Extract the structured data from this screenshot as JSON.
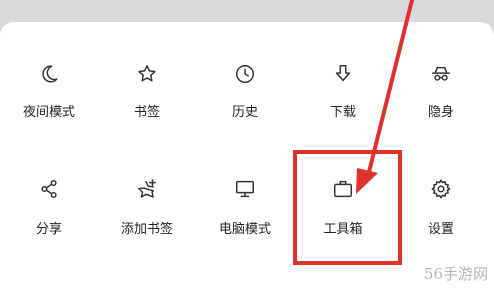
{
  "menu": {
    "row1": [
      {
        "label": "夜间模式",
        "icon": "moon-icon"
      },
      {
        "label": "书签",
        "icon": "star-icon"
      },
      {
        "label": "历史",
        "icon": "clock-icon"
      },
      {
        "label": "下载",
        "icon": "download-icon"
      },
      {
        "label": "隐身",
        "icon": "incognito-icon"
      }
    ],
    "row2": [
      {
        "label": "分享",
        "icon": "share-icon"
      },
      {
        "label": "添加书签",
        "icon": "star-plus-icon"
      },
      {
        "label": "电脑模式",
        "icon": "monitor-icon"
      },
      {
        "label": "工具箱",
        "icon": "toolbox-icon"
      },
      {
        "label": "设置",
        "icon": "gear-icon"
      }
    ]
  },
  "annotation": {
    "highlight_color": "#e0322b",
    "target": "工具箱"
  },
  "watermark": "56手游网"
}
